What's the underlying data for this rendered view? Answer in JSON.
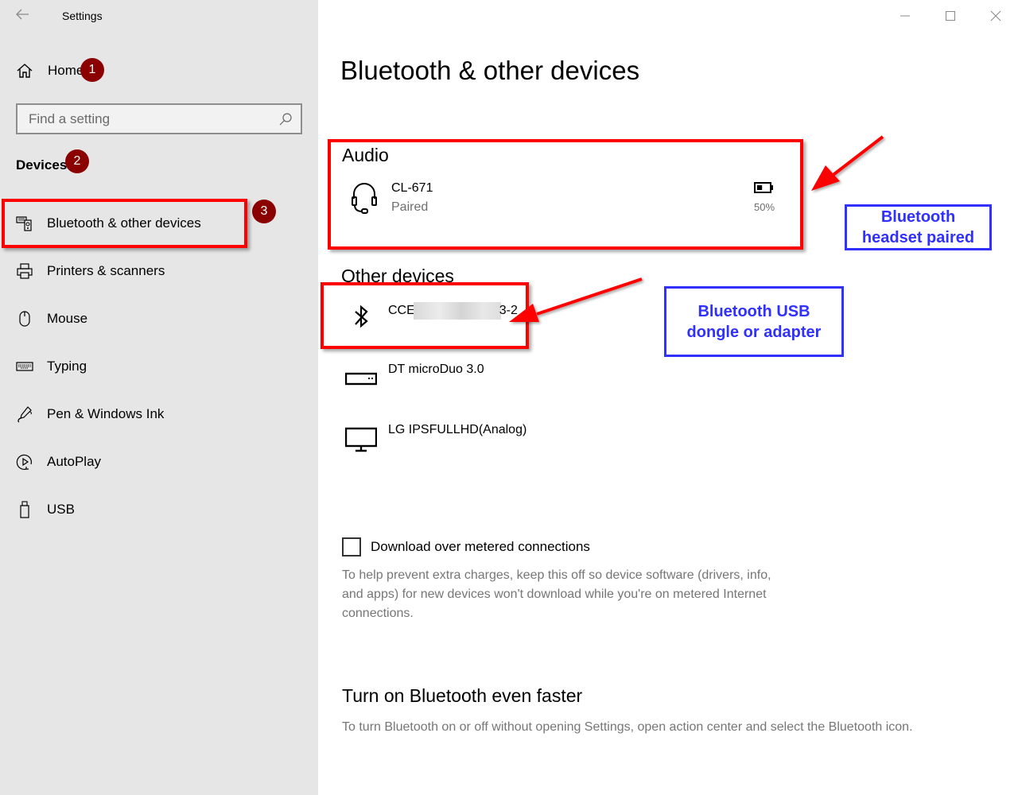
{
  "window": {
    "title": "Settings",
    "controls": {
      "minimize": "minimize-icon",
      "maximize": "maximize-icon",
      "close": "close-icon"
    }
  },
  "sidebar": {
    "home_label": "Home",
    "search_placeholder": "Find a setting",
    "section_label": "Devices",
    "items": [
      {
        "label": "Bluetooth & other devices",
        "icon": "bluetooth-devices-icon",
        "selected": true
      },
      {
        "label": "Printers & scanners",
        "icon": "printer-icon"
      },
      {
        "label": "Mouse",
        "icon": "mouse-icon"
      },
      {
        "label": "Typing",
        "icon": "keyboard-icon"
      },
      {
        "label": "Pen & Windows Ink",
        "icon": "pen-icon"
      },
      {
        "label": "AutoPlay",
        "icon": "autoplay-icon"
      },
      {
        "label": "USB",
        "icon": "usb-icon"
      }
    ]
  },
  "main": {
    "page_title": "Bluetooth & other devices",
    "audio": {
      "title": "Audio",
      "device": {
        "name": "CL-671",
        "status": "Paired",
        "battery": "50%",
        "battery_level": 0.5,
        "icon": "headset-icon"
      }
    },
    "other": {
      "title": "Other devices",
      "devices": [
        {
          "name_start": "CCE",
          "name_end": "3-2",
          "icon": "bluetooth-icon",
          "redacted": true
        },
        {
          "name": "DT microDuo 3.0",
          "icon": "usb-drive-icon"
        },
        {
          "name": "LG IPSFULLHD(Analog)",
          "icon": "monitor-icon"
        }
      ]
    },
    "metered": {
      "label": "Download over metered connections",
      "checked": false,
      "help": "To help prevent extra charges, keep this off so device software (drivers, info, and apps) for new devices won't download while you're on metered Internet connections."
    },
    "faster": {
      "title": "Turn on Bluetooth even faster",
      "desc": "To turn Bluetooth on or off without opening Settings, open action center and select the Bluetooth icon."
    }
  },
  "annotations": {
    "badges": [
      "1",
      "2",
      "3"
    ],
    "callout_headset": "Bluetooth headset paired",
    "callout_dongle": "Bluetooth USB dongle or adapter",
    "colors": {
      "highlight": "#ff0000",
      "callout": "#3030ff",
      "badge": "#8b0000"
    }
  }
}
